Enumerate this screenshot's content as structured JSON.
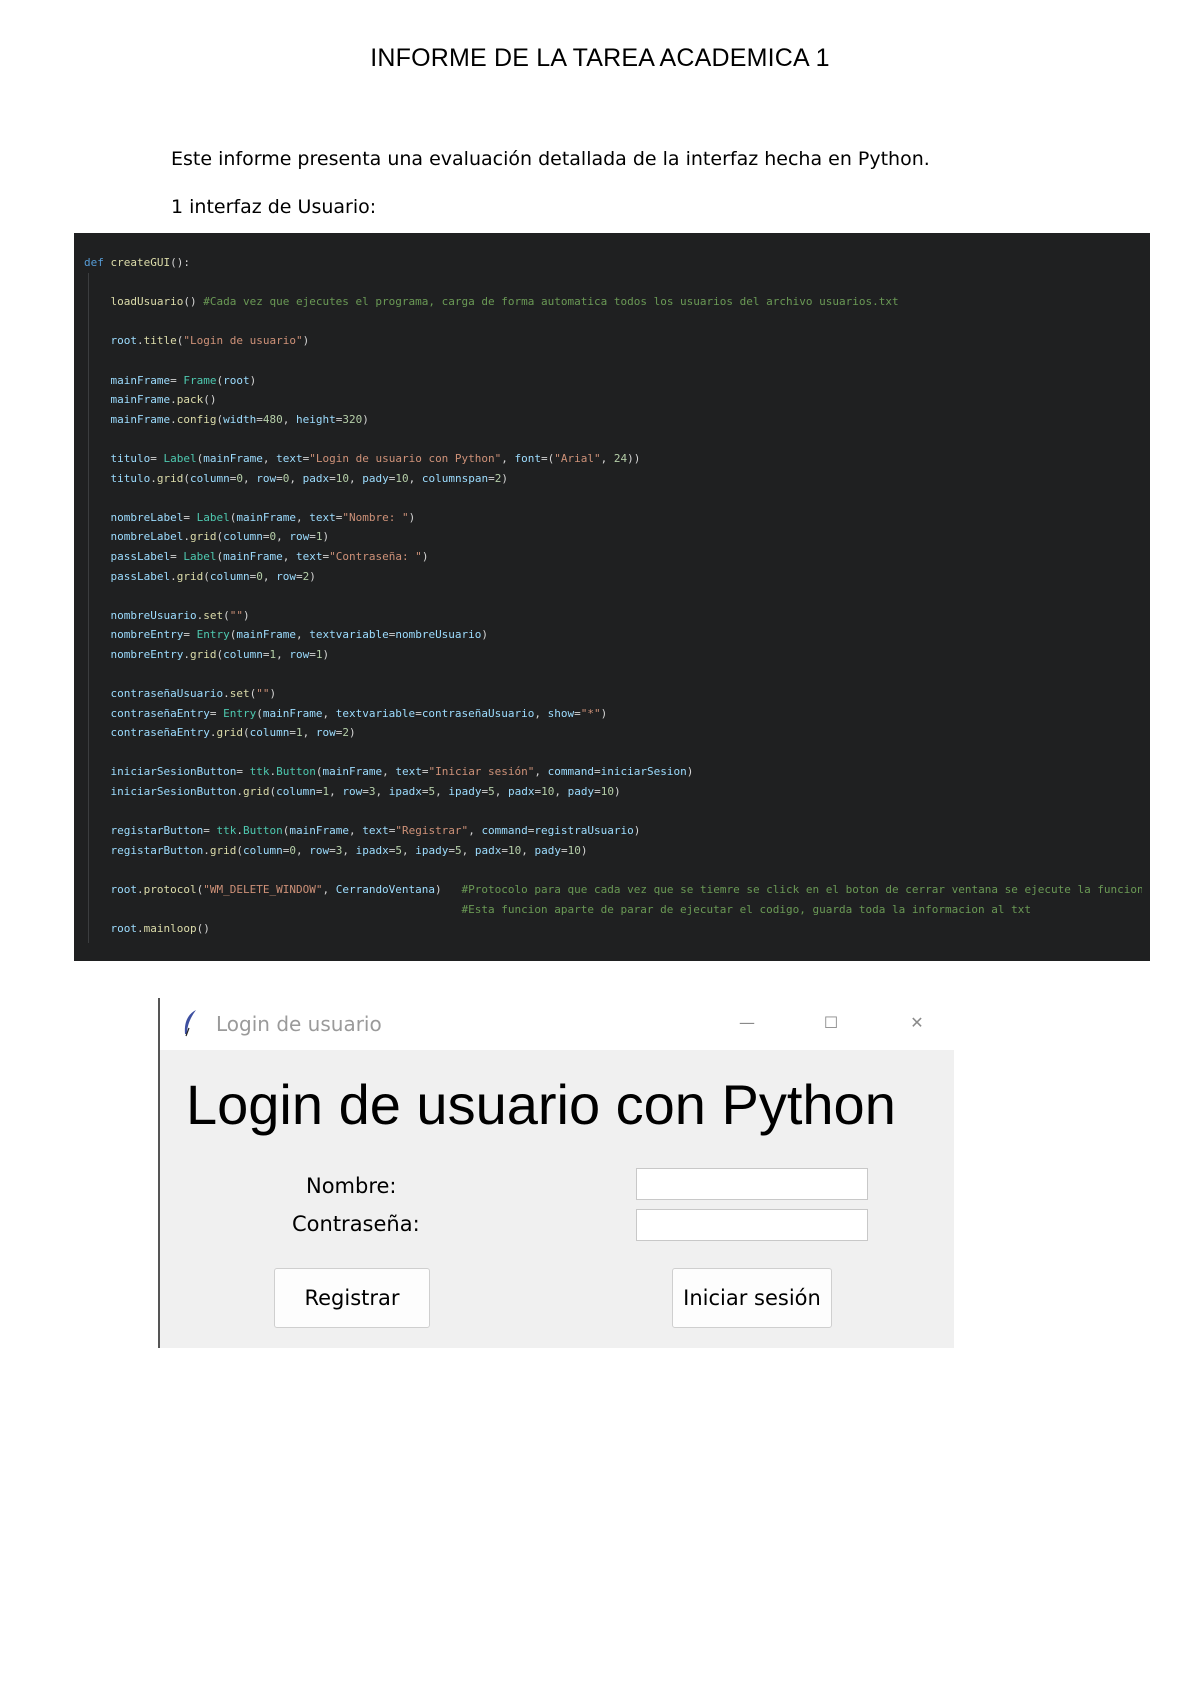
{
  "title": "INFORME DE LA TAREA ACADEMICA 1",
  "paragraphs": {
    "intro": "Este informe presenta una evaluación detallada de la interfaz hecha en Python.",
    "section1": "1 interfaz de Usuario:"
  },
  "code": {
    "lines": [
      "def createGUI():",
      "",
      "    loadUsuario() #Cada vez que ejecutes el programa, carga de forma automatica todos los usuarios del archivo usuarios.txt",
      "",
      "    root.title(\"Login de usuario\")",
      "",
      "    mainFrame= Frame(root)",
      "    mainFrame.pack()",
      "    mainFrame.config(width=480, height=320)",
      "",
      "    titulo= Label(mainFrame, text=\"Login de usuario con Python\", font=(\"Arial\", 24))",
      "    titulo.grid(column=0, row=0, padx=10, pady=10, columnspan=2)",
      "",
      "    nombreLabel= Label(mainFrame, text=\"Nombre: \")",
      "    nombreLabel.grid(column=0, row=1)",
      "    passLabel= Label(mainFrame, text=\"Contraseña: \")",
      "    passLabel.grid(column=0, row=2)",
      "",
      "    nombreUsuario.set(\"\")",
      "    nombreEntry= Entry(mainFrame, textvariable=nombreUsuario)",
      "    nombreEntry.grid(column=1, row=1)",
      "",
      "    contraseñaUsuario.set(\"\")",
      "    contraseñaEntry= Entry(mainFrame, textvariable=contraseñaUsuario, show=\"*\")",
      "    contraseñaEntry.grid(column=1, row=2)",
      "",
      "    iniciarSesionButton= ttk.Button(mainFrame, text=\"Iniciar sesión\", command=iniciarSesion)",
      "    iniciarSesionButton.grid(column=1, row=3, ipadx=5, ipady=5, padx=10, pady=10)",
      "",
      "    registarButton= ttk.Button(mainFrame, text=\"Registrar\", command=registraUsuario)",
      "    registarButton.grid(column=0, row=3, ipadx=5, ipady=5, padx=10, pady=10)",
      "",
      "    root.protocol(\"WM_DELETE_WINDOW\", CerrandoVentana)   #Protocolo para que cada vez que se tiemre se click en el boton de cerrar ventana se ejecute la funcion CerrandoVentana()",
      "                                                         #Esta funcion aparte de parar de ejecutar el codigo, guarda toda la informacion al txt",
      "    root.mainloop()"
    ]
  },
  "window": {
    "title": "Login de usuario",
    "heading": "Login de usuario con Python",
    "nombre_label": "Nombre:",
    "pass_label": "Contraseña:",
    "registrar": "Registrar",
    "iniciar": "Iniciar sesión",
    "minimize_glyph": "—",
    "maximize_glyph": "☐",
    "close_glyph": "✕"
  }
}
